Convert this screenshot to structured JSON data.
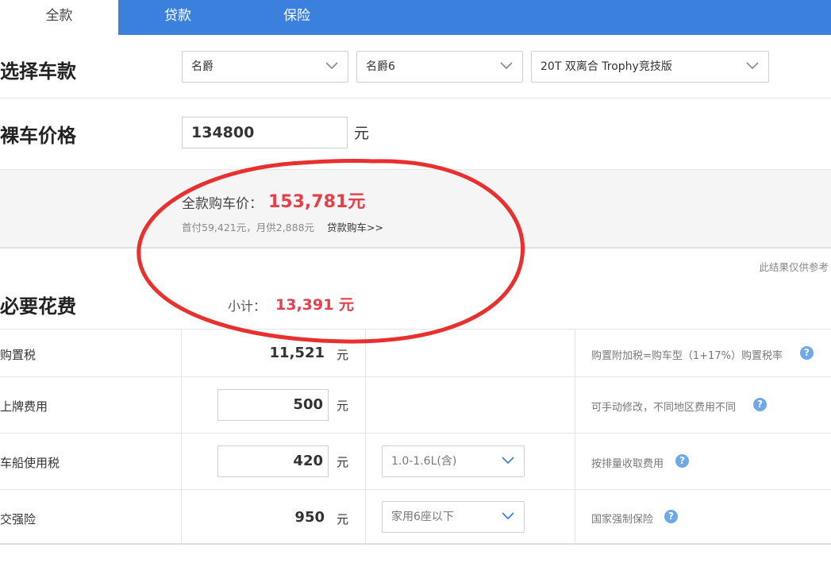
{
  "tabs": [
    {
      "label": "全款",
      "active": true
    },
    {
      "label": "贷款",
      "active": false
    },
    {
      "label": "保险",
      "active": false
    }
  ],
  "select_car": {
    "title": "选择车款",
    "brand": "名爵",
    "model": "名爵6",
    "trim": "20T 双离合 Trophy竞技版"
  },
  "bare_price": {
    "title": "裸车价格",
    "value": "134800",
    "unit": "元"
  },
  "result": {
    "total_label": "全款购车价：",
    "total_value": "153,781元",
    "sub_line": "首付59,421元，月供2,888元",
    "loan_link": "贷款购车>>",
    "disclaimer": "此结果仅供参考"
  },
  "required_costs": {
    "title": "必要花费",
    "subtotal_label": "小计：",
    "subtotal_value": "13,391 元",
    "rows": [
      {
        "label": "购置税",
        "value": "11,521",
        "unit": "元",
        "editable": false,
        "select": "",
        "note": "购置附加税=购车型（1+17%）购置税率"
      },
      {
        "label": "上牌费用",
        "value": "500",
        "unit": "元",
        "editable": true,
        "select": "",
        "note": "可手动修改，不同地区费用不同"
      },
      {
        "label": "车船使用税",
        "value": "420",
        "unit": "元",
        "editable": true,
        "select": "1.0-1.6L(含)",
        "note": "按排量收取费用"
      },
      {
        "label": "交强险",
        "value": "950",
        "unit": "元",
        "editable": false,
        "select": "家用6座以下",
        "note": "国家强制保险"
      }
    ]
  },
  "help_glyph": "?",
  "colors": {
    "tab_bar": "#3a80dc",
    "highlight_red": "#e5404a",
    "annotation_ellipse": "#e8312f",
    "help_icon": "#6fa8e8"
  }
}
